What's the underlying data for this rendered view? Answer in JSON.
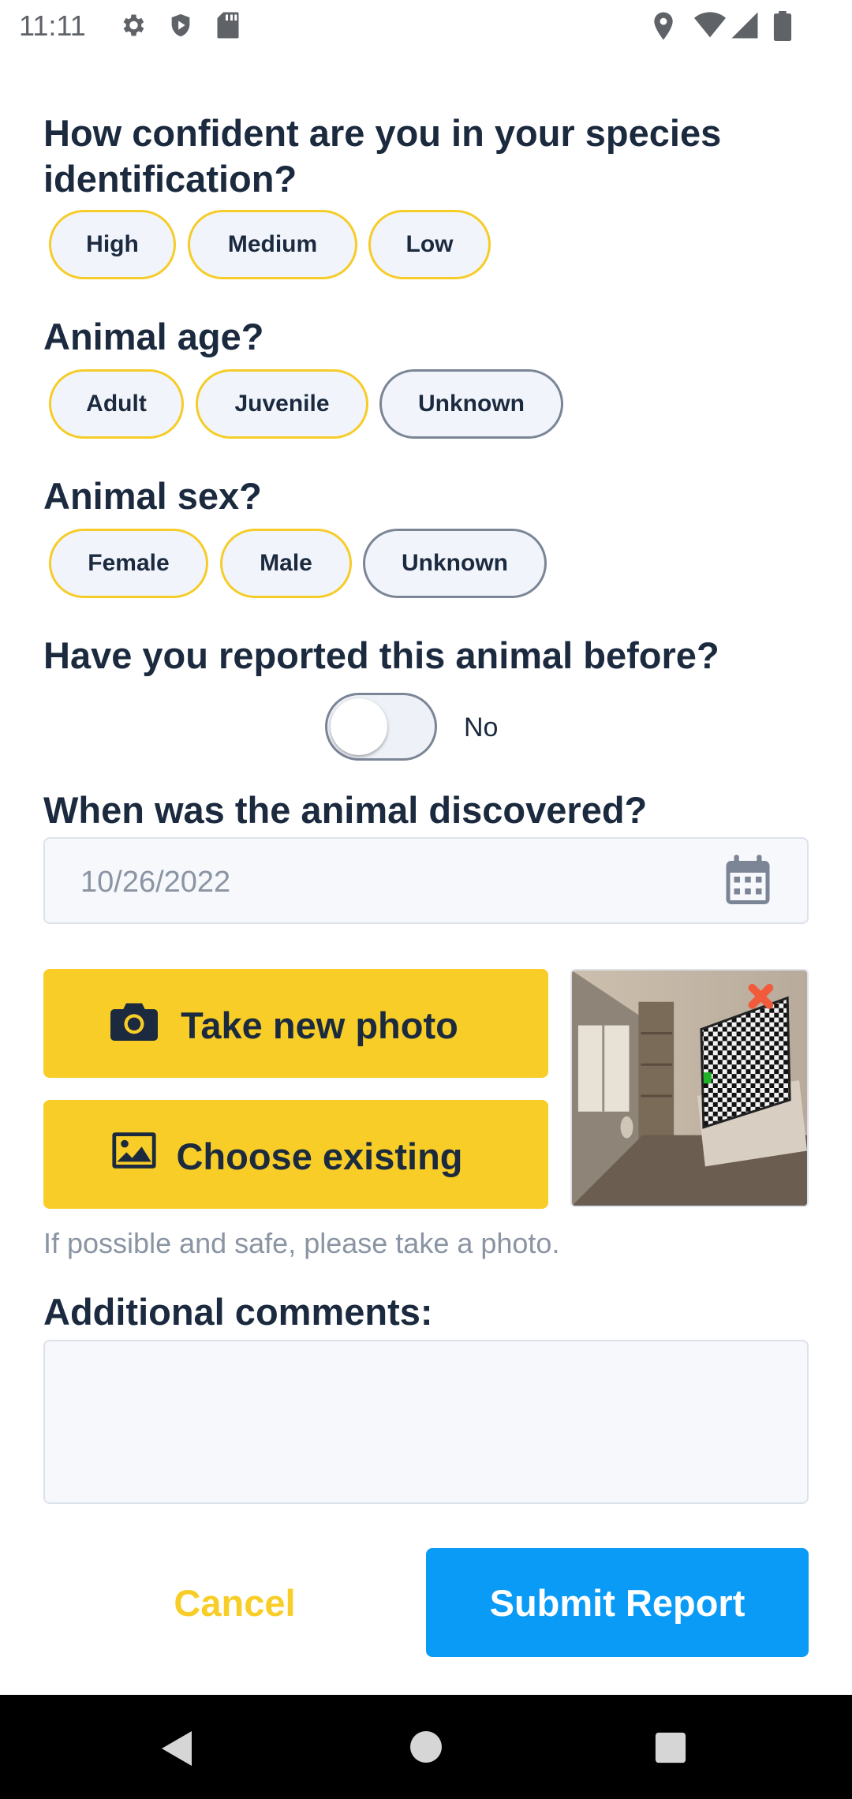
{
  "status_bar": {
    "time": "11:11",
    "icons": [
      "settings-icon",
      "shield-icon",
      "sd-card-icon",
      "location-icon",
      "wifi-icon",
      "signal-icon",
      "battery-icon"
    ]
  },
  "confidence": {
    "question": "How confident are you in your species identification?",
    "options": [
      "High",
      "Medium",
      "Low"
    ]
  },
  "age": {
    "question": "Animal age?",
    "options": [
      "Adult",
      "Juvenile",
      "Unknown"
    ]
  },
  "sex": {
    "question": "Animal sex?",
    "options": [
      "Female",
      "Male",
      "Unknown"
    ]
  },
  "reported_before": {
    "question": "Have you reported this animal before?",
    "toggle_label": "No",
    "toggle_on": false
  },
  "discovered": {
    "question": "When was the animal discovered?",
    "date_value": "10/26/2022"
  },
  "photo": {
    "take_new_label": "Take new photo",
    "choose_existing_label": "Choose existing",
    "hint": "If possible and safe, please take a photo."
  },
  "comments": {
    "label": "Additional comments:",
    "value": ""
  },
  "actions": {
    "cancel_label": "Cancel",
    "submit_label": "Submit Report"
  },
  "colors": {
    "accent_yellow": "#f8cd27",
    "submit_blue": "#0a9bf7",
    "heading": "#1b2a3e"
  }
}
